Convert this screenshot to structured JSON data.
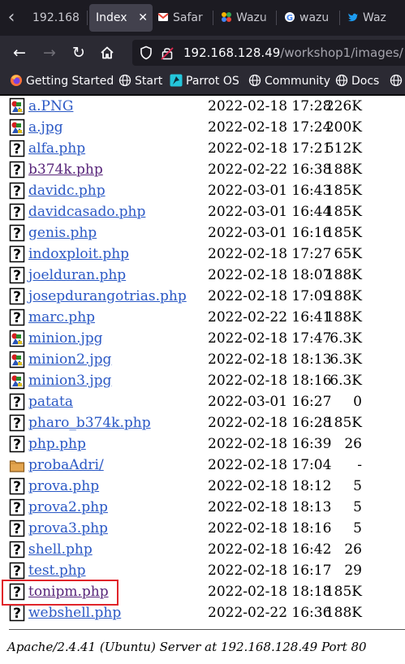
{
  "browser": {
    "tabs": [
      {
        "label": "192.168",
        "active": false
      },
      {
        "label": "Index",
        "active": true
      },
      {
        "label": "Safar",
        "active": false
      },
      {
        "label": "Wazu",
        "active": false
      },
      {
        "label": "wazu",
        "active": false
      },
      {
        "label": "Waz",
        "active": false
      }
    ],
    "url": {
      "host": "192.168.128.49",
      "path": "/workshop1/images/"
    },
    "bookmarks": [
      {
        "label": "Getting Started"
      },
      {
        "label": "Start"
      },
      {
        "label": "Parrot OS"
      },
      {
        "label": "Community"
      },
      {
        "label": "Docs"
      }
    ]
  },
  "listing": {
    "files": [
      {
        "name": "a.PNG",
        "date": "2022-02-18 17:28",
        "size": "226K",
        "icon": "image-icon",
        "visited": false
      },
      {
        "name": "a.jpg",
        "date": "2022-02-18 17:24",
        "size": "200K",
        "icon": "image-icon",
        "visited": false
      },
      {
        "name": "alfa.php",
        "date": "2022-02-18 17:21",
        "size": "512K",
        "icon": "unknown-file-icon",
        "visited": false
      },
      {
        "name": "b374k.php",
        "date": "2022-02-22 16:38",
        "size": "188K",
        "icon": "unknown-file-icon",
        "visited": true
      },
      {
        "name": "davidc.php",
        "date": "2022-03-01 16:43",
        "size": "185K",
        "icon": "unknown-file-icon",
        "visited": false
      },
      {
        "name": "davidcasado.php",
        "date": "2022-03-01 16:44",
        "size": "185K",
        "icon": "unknown-file-icon",
        "visited": false
      },
      {
        "name": "genis.php",
        "date": "2022-03-01 16:16",
        "size": "185K",
        "icon": "unknown-file-icon",
        "visited": false
      },
      {
        "name": "indoxploit.php",
        "date": "2022-02-18 17:27",
        "size": "65K",
        "icon": "unknown-file-icon",
        "visited": false
      },
      {
        "name": "joelduran.php",
        "date": "2022-02-18 18:07",
        "size": "188K",
        "icon": "unknown-file-icon",
        "visited": false
      },
      {
        "name": "josepdurangotrias.php",
        "date": "2022-02-18 17:09",
        "size": "188K",
        "icon": "unknown-file-icon",
        "visited": false
      },
      {
        "name": "marc.php",
        "date": "2022-02-22 16:41",
        "size": "188K",
        "icon": "unknown-file-icon",
        "visited": false
      },
      {
        "name": "minion.jpg",
        "date": "2022-02-18 17:47",
        "size": "6.3K",
        "icon": "image-icon",
        "visited": false
      },
      {
        "name": "minion2.jpg",
        "date": "2022-02-18 18:13",
        "size": "6.3K",
        "icon": "image-icon",
        "visited": false
      },
      {
        "name": "minion3.jpg",
        "date": "2022-02-18 18:16",
        "size": "6.3K",
        "icon": "image-icon",
        "visited": false
      },
      {
        "name": "patata",
        "date": "2022-03-01 16:27",
        "size": "0",
        "icon": "unknown-file-icon",
        "visited": false
      },
      {
        "name": "pharo_b374k.php",
        "date": "2022-02-18 16:28",
        "size": "185K",
        "icon": "unknown-file-icon",
        "visited": false
      },
      {
        "name": "php.php",
        "date": "2022-02-18 16:39",
        "size": "26",
        "icon": "unknown-file-icon",
        "visited": false
      },
      {
        "name": "probaAdri/",
        "date": "2022-02-18 17:04",
        "size": "-",
        "icon": "folder-icon",
        "visited": false
      },
      {
        "name": "prova.php",
        "date": "2022-02-18 18:12",
        "size": "5",
        "icon": "unknown-file-icon",
        "visited": false
      },
      {
        "name": "prova2.php",
        "date": "2022-02-18 18:13",
        "size": "5",
        "icon": "unknown-file-icon",
        "visited": false
      },
      {
        "name": "prova3.php",
        "date": "2022-02-18 18:16",
        "size": "5",
        "icon": "unknown-file-icon",
        "visited": false
      },
      {
        "name": "shell.php",
        "date": "2022-02-18 16:42",
        "size": "26",
        "icon": "unknown-file-icon",
        "visited": false
      },
      {
        "name": "test.php",
        "date": "2022-02-18 16:17",
        "size": "29",
        "icon": "unknown-file-icon",
        "visited": false
      },
      {
        "name": "tonipm.php",
        "date": "2022-02-18 18:18",
        "size": "185K",
        "icon": "unknown-file-icon",
        "visited": true
      },
      {
        "name": "webshell.php",
        "date": "2022-02-22 16:36",
        "size": "188K",
        "icon": "unknown-file-icon",
        "visited": false
      }
    ],
    "highlighted_file": "tonipm.php"
  },
  "footer": {
    "server_signature": "Apache/2.4.41 (Ubuntu) Server at 192.168.128.49 Port 80"
  },
  "colors": {
    "link": "#2a58c5",
    "visited_link": "#58257a",
    "highlight_box": "#e0242a",
    "chrome_dark": "#1c1b22",
    "chrome_toolbar": "#2b2a33"
  }
}
